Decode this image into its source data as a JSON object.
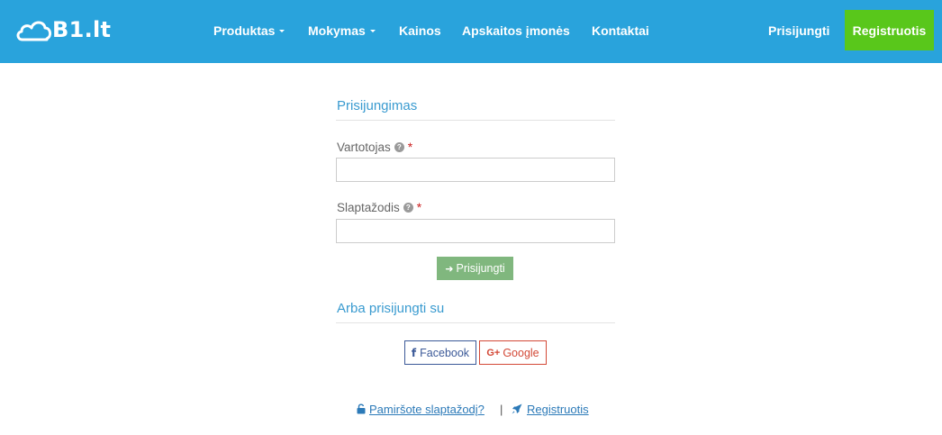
{
  "header": {
    "logo_text": "B1.lt",
    "nav": [
      {
        "label": "Produktas",
        "dropdown": true
      },
      {
        "label": "Mokymas",
        "dropdown": true
      },
      {
        "label": "Kainos",
        "dropdown": false
      },
      {
        "label": "Apskaitos įmonės",
        "dropdown": false
      },
      {
        "label": "Kontaktai",
        "dropdown": false
      }
    ],
    "login_label": "Prisijungti",
    "register_label": "Registruotis"
  },
  "login_form": {
    "title": "Prisijungimas",
    "username": {
      "label": "Vartotojas",
      "required_mark": "*",
      "help_icon": "question-circle-icon",
      "value": "",
      "placeholder": ""
    },
    "password": {
      "label": "Slaptažodis",
      "required_mark": "*",
      "help_icon": "question-circle-icon",
      "value": "",
      "placeholder": ""
    },
    "submit_label": "Prisijungti",
    "submit_icon": "sign-in-icon"
  },
  "social": {
    "title": "Arba prisijungti su",
    "facebook_label": "Facebook",
    "google_label": "Google"
  },
  "footer": {
    "forgot_label": "Pamiršote slaptažodį?",
    "separator": "|",
    "register_label": "Registruotis"
  },
  "colors": {
    "header_bg": "#29a3dc",
    "register_button": "#59c71b",
    "login_button": "#80b77e",
    "section_title": "#3a9bd0",
    "facebook": "#3b5998",
    "google": "#d34836",
    "link": "#2c7ab8"
  }
}
